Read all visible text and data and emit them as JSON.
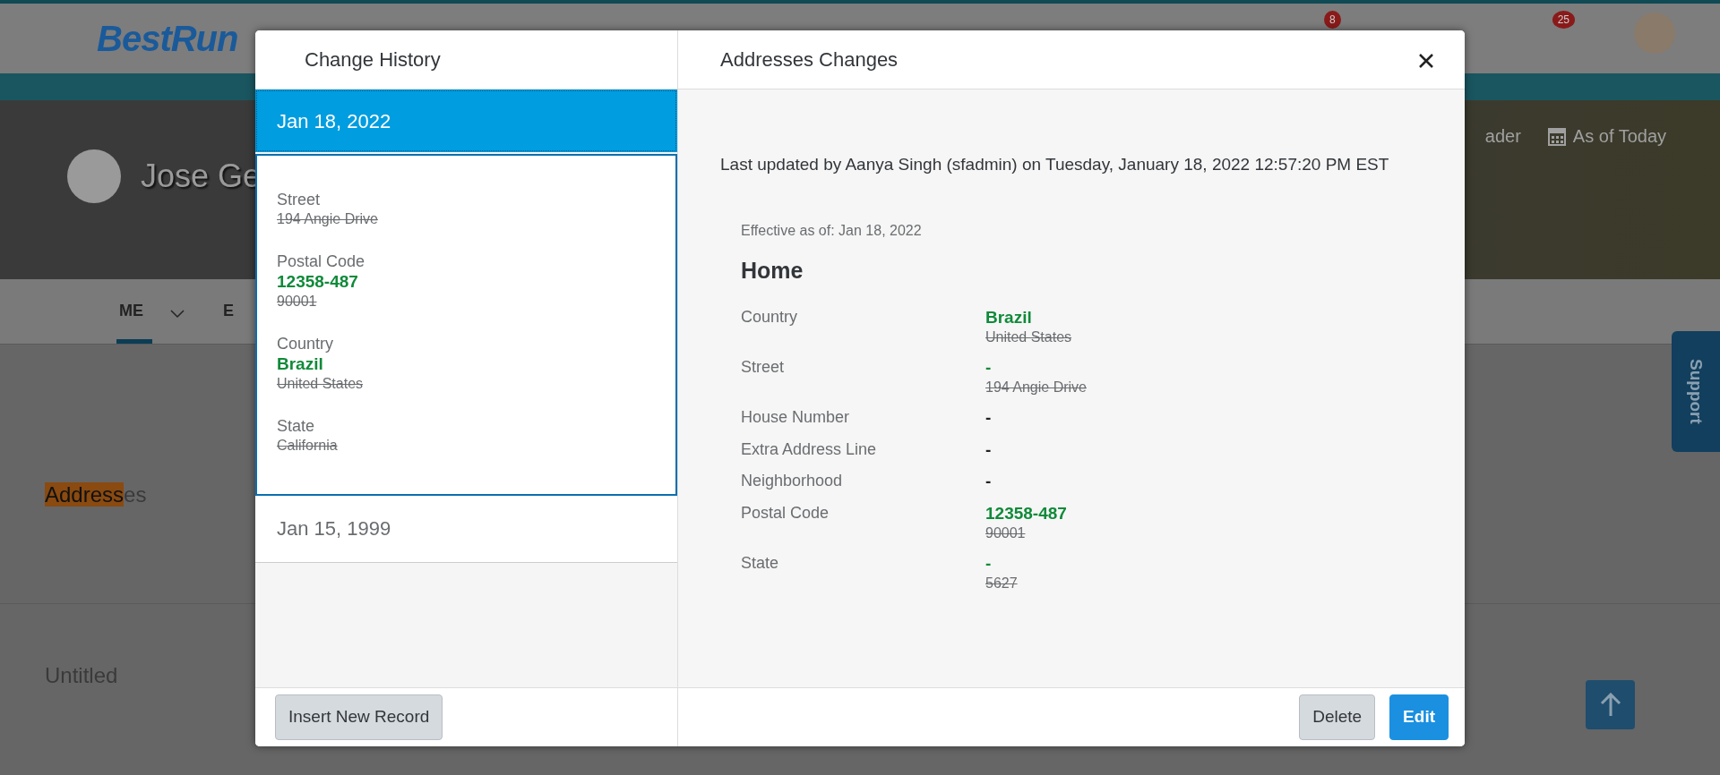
{
  "background": {
    "logo": "BestRun",
    "notification_badges": [
      "8",
      "25"
    ],
    "profile_name": "Jose Ge",
    "hero_actions": [
      "ader",
      "As of Today"
    ],
    "tabs": [
      {
        "label": "ME",
        "selected": true
      },
      {
        "label": "E",
        "selected": false
      }
    ],
    "section_title": {
      "match": "Address",
      "rest": "es"
    },
    "section_2_title": "Untitled",
    "support_tab": "Support"
  },
  "dialog": {
    "history": {
      "title": "Change History",
      "entries": [
        {
          "date": "Jan 18, 2022",
          "selected": true,
          "changes": [
            {
              "label": "Street",
              "old": "194 Angie Drive"
            },
            {
              "label": "Postal Code",
              "new": "12358-487",
              "old": "90001"
            },
            {
              "label": "Country",
              "new": "Brazil",
              "old": "United States"
            },
            {
              "label": "State",
              "old": "California"
            }
          ]
        },
        {
          "date": "Jan 15, 1999",
          "selected": false
        }
      ],
      "button": "Insert New Record"
    },
    "details": {
      "title": "Addresses Changes",
      "last_updated": "Last updated by Aanya Singh (sfadmin) on Tuesday, January 18, 2022 12:57:20 PM EST",
      "effective": "Effective as of: Jan 18, 2022",
      "address_type": "Home",
      "fields": [
        {
          "label": "Country",
          "value": "Brazil",
          "changed": true,
          "old": "United States"
        },
        {
          "label": "Street",
          "value": "-",
          "changed": true,
          "old": "194 Angie Drive"
        },
        {
          "label": "House Number",
          "value": "-",
          "changed": false
        },
        {
          "label": "Extra Address Line",
          "value": "-",
          "changed": false
        },
        {
          "label": "Neighborhood",
          "value": "-",
          "changed": false
        },
        {
          "label": "Postal Code",
          "value": "12358-487",
          "changed": true,
          "old": "90001"
        },
        {
          "label": "State",
          "value": "-",
          "changed": true,
          "old": "5627"
        }
      ],
      "buttons": [
        {
          "label": "Delete",
          "kind": "secondary"
        },
        {
          "label": "Edit",
          "kind": "primary"
        }
      ]
    }
  }
}
